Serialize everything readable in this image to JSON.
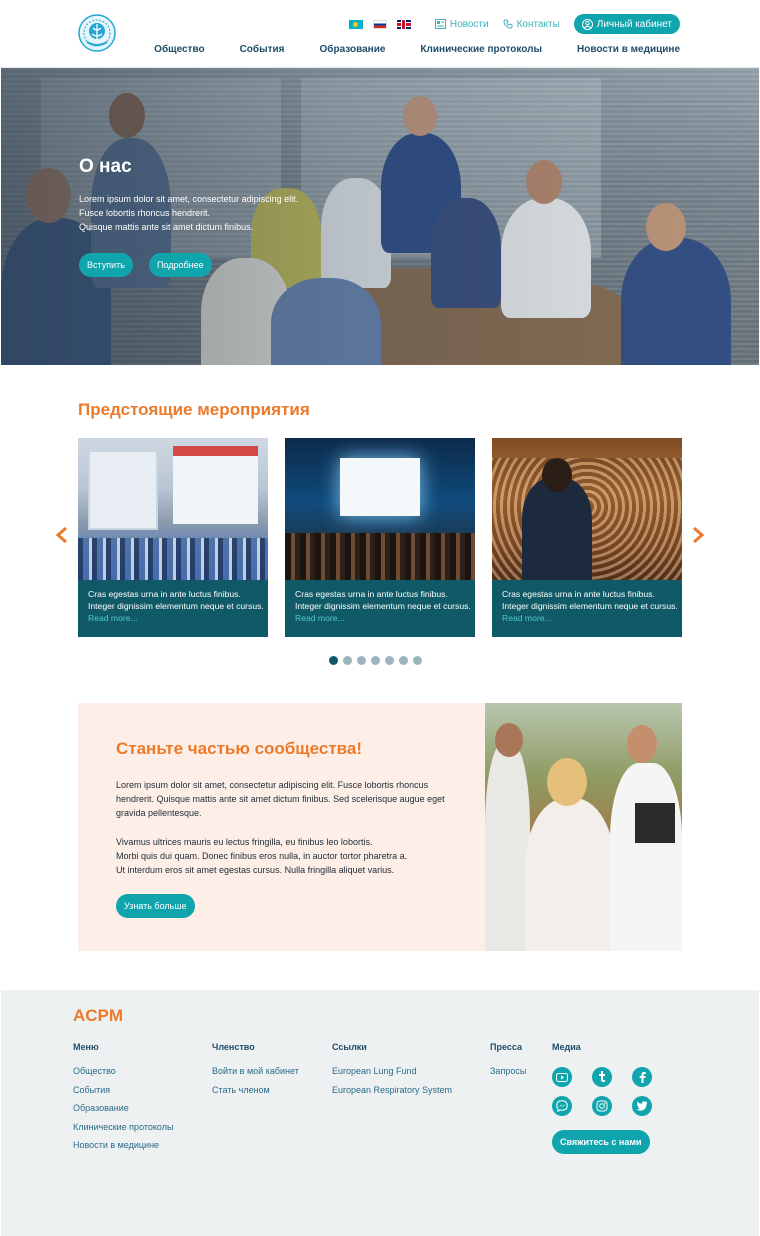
{
  "header": {
    "languages": [
      "kz",
      "ru",
      "en"
    ],
    "top_links": {
      "news": "Новости",
      "contacts": "Контакты"
    },
    "cabinet_label": "Личный кабинет",
    "nav": [
      "Общество",
      "События",
      "Образование",
      "Клинические протоколы",
      "Новости в медицине"
    ]
  },
  "hero": {
    "title": "О нас",
    "lines": [
      "Lorem ipsum dolor sit amet, consectetur adipiscing elit.",
      "Fusce lobortis rhoncus hendrerit.",
      "Quisque mattis ante sit amet dictum finibus."
    ],
    "buttons": {
      "join": "Вступить",
      "more": "Подробнее"
    }
  },
  "events": {
    "title": "Предстоящие мероприятия",
    "cards": [
      {
        "text": "Cras egestas urna in ante luctus finibus. Integer dignissim elementum neque et cursus.",
        "more": "Read more..."
      },
      {
        "text": "Cras egestas urna in ante luctus finibus. Integer dignissim elementum neque et cursus.",
        "more": "Read more..."
      },
      {
        "text": "Cras egestas urna in ante luctus finibus. Integer dignissim elementum neque et cursus.",
        "more": "Read more..."
      }
    ],
    "pagination": {
      "total": 7,
      "active": 1
    }
  },
  "community": {
    "title": "Станьте частью сообщества!",
    "p1": "Lorem ipsum dolor sit amet, consectetur adipiscing elit. Fusce lobortis rhoncus hendrerit. Quisque mattis ante sit amet dictum finibus. Sed scelerisque augue eget gravida pellentesque.",
    "p2_lines": [
      "Vivamus ultrices mauris eu lectus fringilla, eu finibus leo lobortis.",
      "Morbi quis dui quam. Donec finibus eros nulla, in auctor tortor pharetra a.",
      "Ut interdum eros sit amet egestas cursus. Nulla fringilla aliquet varius."
    ],
    "button": "Узнать больше"
  },
  "footer": {
    "brand": "ACPM",
    "menu": {
      "title": "Меню",
      "items": [
        "Общество",
        "События",
        "Образование",
        "Клинические протоколы",
        "Новости в медицине"
      ]
    },
    "membership": {
      "title": "Членство",
      "items": [
        "Войти в мой кабинет",
        "Стать членом"
      ]
    },
    "links": {
      "title": "Ссылки",
      "items": [
        "European Lung Fund",
        "European Respiratory System"
      ]
    },
    "press": {
      "title": "Пресса",
      "items": [
        "Запросы"
      ]
    },
    "media": {
      "title": "Медиа",
      "icons": [
        "youtube-icon",
        "tumblr-icon",
        "facebook-icon",
        "messenger-icon",
        "instagram-icon",
        "twitter-icon"
      ]
    },
    "contact_button": "Свяжитесь с нами"
  },
  "colors": {
    "accent": "#10a5ad",
    "orange": "#ec7a2a",
    "navy": "#1e4e6b",
    "card": "#0f5a66"
  }
}
